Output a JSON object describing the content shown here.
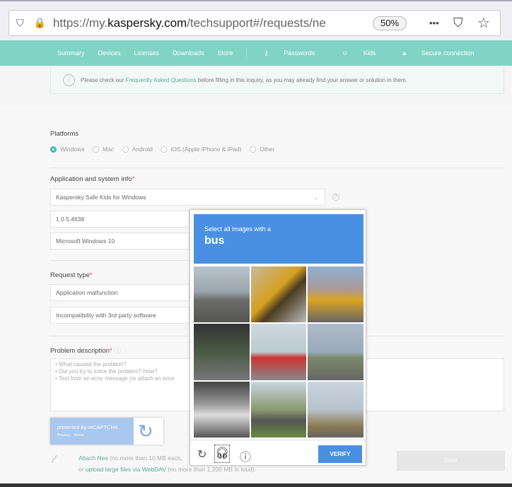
{
  "browser": {
    "url_prefix": "https://my.",
    "url_domain": "kaspersky.com",
    "url_rest": "/techsupport#/requests/ne",
    "zoom": "50%",
    "more": "•••"
  },
  "nav": {
    "items": [
      "Summary",
      "Devices",
      "Licenses",
      "Downloads",
      "Store"
    ],
    "passwords": "Passwords",
    "kids": "Kids",
    "secure": "Secure connection"
  },
  "info": {
    "pre": "Please check our ",
    "link": "Frequently Asked Questions",
    "post": " before filling in this inquiry, as you may already find your answer or solution in them."
  },
  "platforms": {
    "label": "Platforms",
    "options": [
      "Windows",
      "Mac",
      "Android",
      "iOS (Apple iPhone & iPad)",
      "Other"
    ],
    "selected": 0
  },
  "app": {
    "label": "Application and system info",
    "app": "Kaspersky Safe Kids for Windows",
    "version": "1.0.5.4638",
    "os": "Microsoft Windows 10"
  },
  "request": {
    "label": "Request type",
    "type": "Application malfunction",
    "subtype": "Incompatibility with 3rd party software"
  },
  "problem": {
    "label": "Problem description",
    "placeholder": "• What caused the problem?\n• Did you try to solve the problem? How?\n• Text from an error message (or attach an error"
  },
  "recaptcha": {
    "protected": "protected by reCAPTCHA",
    "links": "Privacy - Terms"
  },
  "attach": {
    "link": "Attach files",
    "note": " (no more than 10 MB each,",
    "or": "or ",
    "webdav": "upload large files via WebDAV",
    "note2": " (no more than 1,200 MB in total)."
  },
  "send": "Send",
  "captcha": {
    "instruction": "Select all images with a",
    "target": "bus",
    "verify": "VERIFY"
  }
}
